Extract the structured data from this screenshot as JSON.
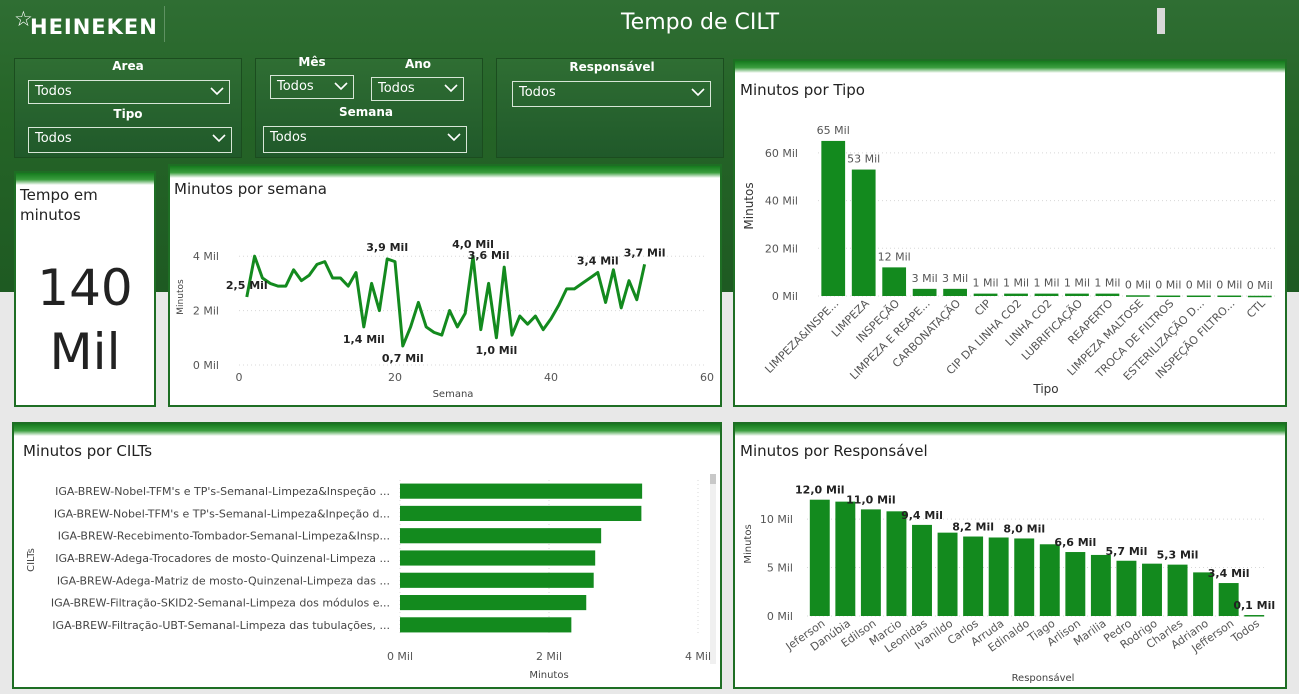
{
  "header": {
    "brand": "HEINEKEN",
    "title": "Tempo de CILT"
  },
  "filters": {
    "area": {
      "label": "Area",
      "value": "Todos"
    },
    "tipo": {
      "label": "Tipo",
      "value": "Todos"
    },
    "mes": {
      "label": "Mês",
      "value": "Todos"
    },
    "ano": {
      "label": "Ano",
      "value": "Todos"
    },
    "semana": {
      "label": "Semana",
      "value": "Todos"
    },
    "responsavel": {
      "label": "Responsável",
      "value": "Todos"
    }
  },
  "kpi": {
    "title": "Tempo em minutos",
    "value_line1": "140",
    "value_line2": "Mil"
  },
  "colors": {
    "accent": "#138a1e",
    "header": "#256427"
  },
  "charts": {
    "semana": {
      "title": "Minutos por semana",
      "xlabel": "Semana",
      "ylabel": "Minutos",
      "yticks": [
        "0 Mil",
        "2 Mil",
        "4 Mil"
      ],
      "xticks": [
        "0",
        "20",
        "40",
        "60"
      ],
      "data_labels": [
        {
          "text": "2,5 Mil",
          "x": 1,
          "y": 2500
        },
        {
          "text": "3,9 Mil",
          "x": 19,
          "y": 3900
        },
        {
          "text": "1,4 Mil",
          "x": 16,
          "y": 1400
        },
        {
          "text": "0,7 Mil",
          "x": 21,
          "y": 700
        },
        {
          "text": "4,0 Mil",
          "x": 30,
          "y": 4000
        },
        {
          "text": "3,6 Mil",
          "x": 32,
          "y": 3600
        },
        {
          "text": "1,0 Mil",
          "x": 33,
          "y": 1000
        },
        {
          "text": "3,4 Mil",
          "x": 46,
          "y": 3400
        },
        {
          "text": "3,7 Mil",
          "x": 52,
          "y": 3700
        }
      ]
    },
    "tipo": {
      "title": "Minutos por Tipo",
      "xlabel": "Tipo",
      "ylabel": "Minutos",
      "yticks": [
        "0 Mil",
        "20 Mil",
        "40 Mil",
        "60 Mil"
      ],
      "bar_labels": [
        "65 Mil",
        "53 Mil",
        "12 Mil",
        "3 Mil",
        "3 Mil",
        "1 Mil",
        "1 Mil",
        "1 Mil",
        "1 Mil",
        "1 Mil",
        "0 Mil",
        "0 Mil",
        "0 Mil",
        "0 Mil",
        "0 Mil"
      ]
    },
    "cilts": {
      "title": "Minutos por CILTs",
      "xlabel": "Minutos",
      "ylabel": "CILTs",
      "xticks": [
        "0 Mil",
        "2 Mil",
        "4 Mil"
      ]
    },
    "responsavel": {
      "title": "Minutos por Responsável",
      "xlabel": "Responsável",
      "ylabel": "Minutos",
      "yticks": [
        "0 Mil",
        "5 Mil",
        "10 Mil"
      ],
      "bar_labels": [
        "12,0 Mil",
        "",
        "11,0 Mil",
        "",
        "9,4 Mil",
        "",
        "8,2 Mil",
        "",
        "8,0 Mil",
        "",
        "6,6 Mil",
        "",
        "5,7 Mil",
        "",
        "5,3 Mil",
        "",
        "3,4 Mil",
        "0,1 Mil"
      ]
    }
  },
  "chart_data": [
    {
      "type": "line",
      "title": "Minutos por semana",
      "xlabel": "Semana",
      "ylabel": "Minutos",
      "xlim": [
        0,
        60
      ],
      "ylim": [
        0,
        5000
      ],
      "x": [
        1,
        2,
        3,
        4,
        5,
        6,
        7,
        8,
        9,
        10,
        11,
        12,
        13,
        14,
        15,
        16,
        17,
        18,
        19,
        20,
        21,
        22,
        23,
        24,
        25,
        26,
        27,
        28,
        29,
        30,
        31,
        32,
        33,
        34,
        35,
        36,
        37,
        38,
        39,
        40,
        41,
        42,
        43,
        44,
        45,
        46,
        47,
        48,
        49,
        50,
        51,
        52
      ],
      "y": [
        2500,
        4000,
        3200,
        3000,
        2900,
        2900,
        3500,
        3100,
        3300,
        3700,
        3800,
        3200,
        3200,
        2900,
        3400,
        1400,
        3000,
        2000,
        3900,
        3800,
        700,
        1400,
        2300,
        1400,
        1200,
        1100,
        2000,
        1400,
        1900,
        4000,
        1300,
        3000,
        1000,
        3600,
        1100,
        1800,
        1500,
        1800,
        1300,
        1700,
        2200,
        2800,
        2800,
        3000,
        3200,
        3400,
        2300,
        3500,
        2100,
        3100,
        2400,
        3700
      ]
    },
    {
      "type": "bar",
      "title": "Minutos por Tipo",
      "xlabel": "Tipo",
      "ylabel": "Minutos",
      "ylim": [
        0,
        70000
      ],
      "categories": [
        "LIMPEZA&INSPE...",
        "LIMPEZA",
        "INSPEÇÃO",
        "LIMPEZA E REAPE...",
        "CARBONATAÇÃO",
        "CIP",
        "CIP DA LINHA CO2",
        "LINHA CO2",
        "LUBRIFICAÇÃO",
        "REAPERTO",
        "LIMPEZA MALTOSE",
        "TROCA DE FILTROS",
        "ESTERILIZAÇÃO D...",
        "INSPEÇÃO FILTRO...",
        "CTL"
      ],
      "values": [
        65000,
        53000,
        12000,
        3000,
        3000,
        1000,
        1000,
        1000,
        1000,
        1000,
        300,
        200,
        200,
        200,
        100
      ]
    },
    {
      "type": "bar",
      "orientation": "horizontal",
      "title": "Minutos por CILTs",
      "xlabel": "Minutos",
      "ylabel": "CILTs",
      "xlim": [
        0,
        4000
      ],
      "categories": [
        "IGA-BREW-Nobel-TFM's e TP's-Semanal-Limpeza&Inspeção ...",
        "IGA-BREW-Nobel-TFM's e TP's-Semanal-Limpeza&Inpeção d...",
        "IGA-BREW-Recebimento-Tombador-Semanal-Limpeza&Insp...",
        "IGA-BREW-Adega-Trocadores de mosto-Quinzenal-Limpeza ...",
        "IGA-BREW-Adega-Matriz de mosto-Quinzenal-Limpeza das ...",
        "IGA-BREW-Filtração-SKID2-Semanal-Limpeza dos módulos e...",
        "IGA-BREW-Filtração-UBT-Semanal-Limpeza das tubulações, ..."
      ],
      "values": [
        3250,
        3240,
        2700,
        2620,
        2600,
        2500,
        2300
      ]
    },
    {
      "type": "bar",
      "title": "Minutos por Responsável",
      "xlabel": "Responsável",
      "ylabel": "Minutos",
      "ylim": [
        0,
        13000
      ],
      "categories": [
        "Jeferson",
        "Danúbia",
        "Edilson",
        "Marcio",
        "Leonidas",
        "Ivanildo",
        "Carlos",
        "Arruda",
        "Edinaldo",
        "Tiago",
        "Arlison",
        "Marilia",
        "Pedro",
        "Rodrigo",
        "Charles",
        "Adriano",
        "Jefferson",
        "Todos"
      ],
      "values": [
        12000,
        11800,
        11000,
        10800,
        9400,
        8600,
        8200,
        8100,
        8000,
        7400,
        6600,
        6300,
        5700,
        5400,
        5300,
        4500,
        3400,
        100
      ]
    }
  ]
}
